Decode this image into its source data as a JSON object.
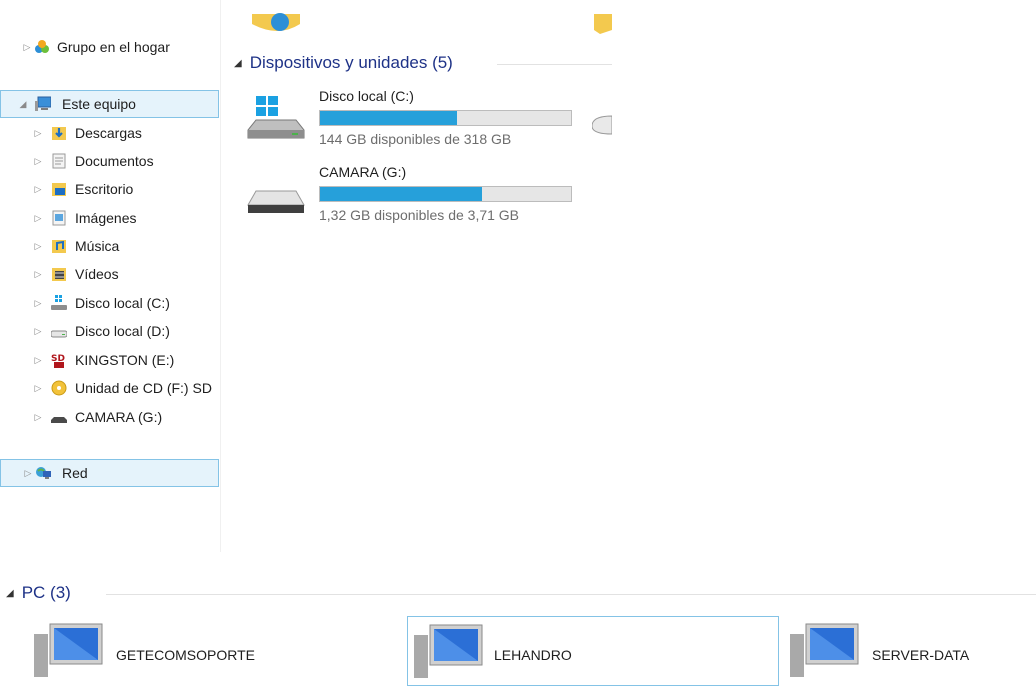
{
  "nav": {
    "homegroup": "Grupo en el hogar",
    "this_pc": "Este equipo",
    "items": [
      {
        "label": "Descargas",
        "icon": "downloads-folder-icon"
      },
      {
        "label": "Documentos",
        "icon": "documents-folder-icon"
      },
      {
        "label": "Escritorio",
        "icon": "desktop-folder-icon"
      },
      {
        "label": "Imágenes",
        "icon": "pictures-folder-icon"
      },
      {
        "label": "Música",
        "icon": "music-folder-icon"
      },
      {
        "label": "Vídeos",
        "icon": "videos-folder-icon"
      },
      {
        "label": "Disco local (C:)",
        "icon": "windows-drive-icon"
      },
      {
        "label": "Disco local (D:)",
        "icon": "hard-drive-icon"
      },
      {
        "label": "KINGSTON (E:)",
        "icon": "sd-card-icon"
      },
      {
        "label": "Unidad de CD (F:) SD",
        "icon": "cd-drive-icon"
      },
      {
        "label": "CAMARA (G:)",
        "icon": "removable-drive-icon"
      }
    ],
    "network": "Red"
  },
  "devices": {
    "header": "Dispositivos y unidades (5)",
    "drives": [
      {
        "name": "Disco local (C:)",
        "free_text": "144 GB disponibles de 318 GB",
        "used_fraction": 0.547
      },
      {
        "name": "CAMARA (G:)",
        "free_text": "1,32 GB disponibles de 3,71 GB",
        "used_fraction": 0.644
      }
    ]
  },
  "pcs": {
    "header": "PC (3)",
    "items": [
      {
        "name": "GETECOMSOPORTE"
      },
      {
        "name": "LEHANDRO"
      },
      {
        "name": "SERVER-DATA"
      }
    ]
  },
  "colors": {
    "accent": "#26a0da",
    "header_text": "#1e3287",
    "selection_border": "#84c3e6",
    "selection_fill": "#e5f3fb"
  }
}
